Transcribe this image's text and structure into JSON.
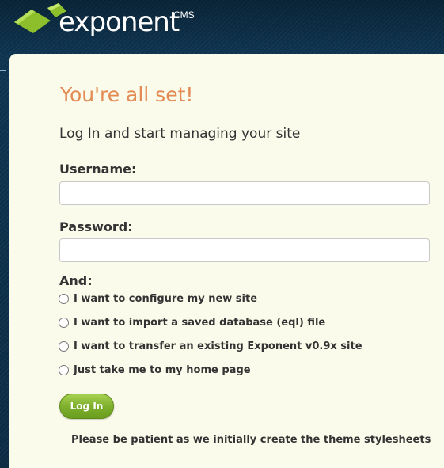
{
  "header": {
    "logo_prefix": "ex",
    "logo_rest": "ponent",
    "logo_sup": "CMS",
    "logo_icon": "exponent-leaf-icon"
  },
  "main": {
    "title": "You're all set!",
    "subtitle": "Log In and start managing your site",
    "username_label": "Username:",
    "username_value": "",
    "password_label": "Password:",
    "password_value": "",
    "and_label": "And:",
    "options": [
      {
        "label": "I want to configure my new site",
        "selected": false
      },
      {
        "label": "I want to import a saved database (eql) file",
        "selected": false
      },
      {
        "label": "I want to transfer an existing Exponent v0.9x site",
        "selected": false
      },
      {
        "label": "Just take me to my home page",
        "selected": false
      }
    ],
    "login_label": "Log In",
    "patience_note": "Please be patient as we initially create the theme stylesheets"
  },
  "colors": {
    "title": "#e28a52",
    "panel_bg": "#fbfbeb",
    "page_bg": "#0b2d45",
    "button": "#7fb02e"
  }
}
